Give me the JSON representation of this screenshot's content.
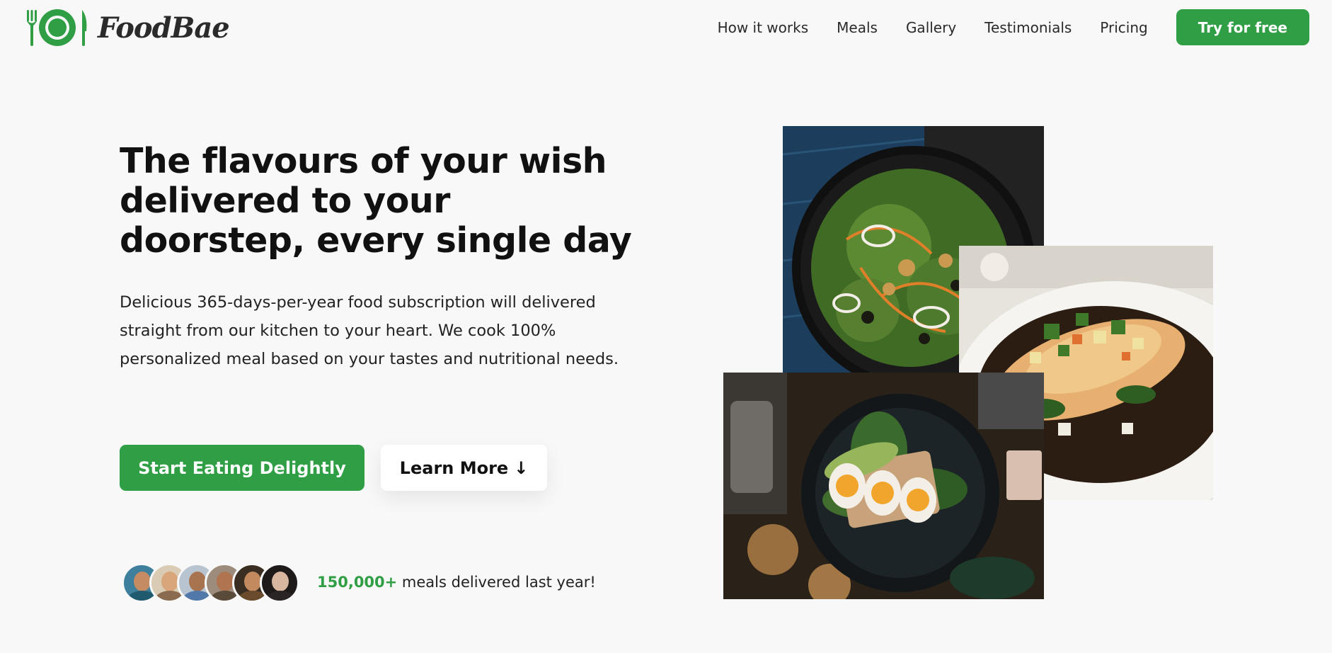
{
  "brand": {
    "name": "FoodBae",
    "accent_color": "#2f9e44",
    "logo_icon": "plate-fork-knife-icon"
  },
  "nav": {
    "links": [
      "How it works",
      "Meals",
      "Gallery",
      "Testimonials",
      "Pricing"
    ],
    "cta": "Try for free"
  },
  "hero": {
    "title": "The flavours of your wish delivered to your doorstep, every single day",
    "description": "Delicious 365-days-per-year food subscription will delivered straight from our kitchen to your heart. We cook 100% personalized meal based on your tastes and nutritional needs.",
    "primary_button": "Start Eating Delightly",
    "secondary_button": "Learn More",
    "secondary_button_icon": "↓",
    "delivered_count": "150,000+",
    "delivered_text": " meals delivered last year!",
    "avatar_count": 6
  },
  "images": [
    {
      "name": "salad-image",
      "subject": "green salad plate"
    },
    {
      "name": "fish-image",
      "subject": "fish dish in white bowl"
    },
    {
      "name": "eggs-image",
      "subject": "boiled eggs and avocado plate"
    }
  ]
}
